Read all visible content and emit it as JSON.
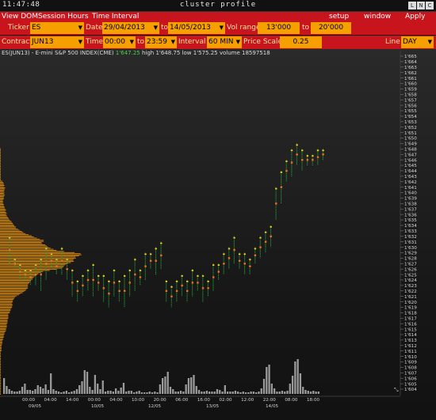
{
  "titlebar": {
    "clock": "11:47:48",
    "title": "cluster profile",
    "buttons": [
      "L",
      "N",
      "C"
    ]
  },
  "menu": {
    "left": [
      "View DOM",
      "Session Hours",
      "Time Interval"
    ],
    "right": [
      "setup",
      "window",
      "Apply"
    ]
  },
  "row1": {
    "ticker_label": "Ticker",
    "ticker_value": "ES",
    "date_label": "Date",
    "date_from": "29/04/2013",
    "to_label": "to",
    "date_to": "14/05/2013",
    "vol_range_label": "Vol range",
    "vol_from": "13'000",
    "vol_to_label": "to",
    "vol_to": "20'000"
  },
  "row2": {
    "contract_label": "Contract",
    "contract_value": "JUN13",
    "time_label": "Time",
    "time_from": "00:00",
    "to_label": "to",
    "time_to": "23:59",
    "interval_label": "Interval",
    "interval_value": "60 MIN",
    "price_scale_label": "Price Scale",
    "price_scale_value": "0.25",
    "line_label": "Line",
    "line_value": "DAY"
  },
  "info": {
    "symbol": "ES(JUN13) - E-mini S&P 500 INDEX(CME)",
    "last": "1'647.25",
    "high": "high 1'648.75",
    "low": "low 1'575.25",
    "volume": "volume 18597518"
  },
  "colors": {
    "menubar": "#c8141c",
    "field": "#f6a000",
    "profile": "#d98a14",
    "cluster_green": "#1f9e3a",
    "cluster_orange": "#ef6d1a",
    "cluster_yellow": "#f5c518"
  },
  "chart_data": {
    "type": "bar",
    "price_axis": {
      "ticks": [
        "1'665",
        "1'664",
        "1'663",
        "1'662",
        "1'661",
        "1'660",
        "1'659",
        "1'658",
        "1'657",
        "1'656",
        "1'655",
        "1'654",
        "1'653",
        "1'652",
        "1'651",
        "1'650",
        "1'649",
        "1'648",
        "1'647",
        "1'646",
        "1'645",
        "1'644",
        "1'643",
        "1'642",
        "1'641",
        "1'640",
        "1'639",
        "1'638",
        "1'637",
        "1'636",
        "1'635",
        "1'634",
        "1'633",
        "1'632",
        "1'631",
        "1'630",
        "1'629",
        "1'628",
        "1'627",
        "1'626",
        "1'625",
        "1'624",
        "1'623",
        "1'622",
        "1'621",
        "1'620",
        "1'619",
        "1'618",
        "1'617",
        "1'616",
        "1'615",
        "1'614",
        "1'613",
        "1'612",
        "1'611",
        "1'610",
        "1'609",
        "1'608",
        "1'607",
        "1'606",
        "1'605",
        "1'604"
      ],
      "range": [
        1603.5,
        1665.5
      ]
    },
    "time_axis": {
      "ticks": [
        "00:00",
        "04:00",
        "14:00",
        "00:00",
        "04:00",
        "10:00",
        "20:00",
        "06:00",
        "16:00",
        "02:00",
        "12:00",
        "22:00",
        "08:00",
        "18:00"
      ],
      "dates": [
        "09/05",
        "10/05",
        "12/05",
        "13/05",
        "14/05"
      ]
    },
    "price_series": [
      {
        "low": 1627,
        "high": 1632
      },
      {
        "low": 1626,
        "high": 1628
      },
      {
        "low": 1624,
        "high": 1627
      },
      {
        "low": 1624,
        "high": 1626
      },
      {
        "low": 1623,
        "high": 1626
      },
      {
        "low": 1623,
        "high": 1627
      },
      {
        "low": 1622,
        "high": 1628
      },
      {
        "low": 1624,
        "high": 1630
      },
      {
        "low": 1626,
        "high": 1629
      },
      {
        "low": 1625,
        "high": 1628
      },
      {
        "low": 1625,
        "high": 1630
      },
      {
        "low": 1624,
        "high": 1628
      },
      {
        "low": 1621,
        "high": 1626
      },
      {
        "low": 1620,
        "high": 1624
      },
      {
        "low": 1621,
        "high": 1625
      },
      {
        "low": 1622,
        "high": 1626
      },
      {
        "low": 1621,
        "high": 1627
      },
      {
        "low": 1622,
        "high": 1625
      },
      {
        "low": 1620,
        "high": 1625
      },
      {
        "low": 1619,
        "high": 1624
      },
      {
        "low": 1621,
        "high": 1626
      },
      {
        "low": 1620,
        "high": 1624
      },
      {
        "low": 1619,
        "high": 1625
      },
      {
        "low": 1621,
        "high": 1626
      },
      {
        "low": 1622,
        "high": 1628
      },
      {
        "low": 1623,
        "high": 1626
      },
      {
        "low": 1624,
        "high": 1629
      },
      {
        "low": 1626,
        "high": 1629
      },
      {
        "low": 1625,
        "high": 1630
      },
      {
        "low": 1626,
        "high": 1631
      },
      {
        "low": 1620,
        "high": 1624
      },
      {
        "low": 1619,
        "high": 1623
      },
      {
        "low": 1620,
        "high": 1624
      },
      {
        "low": 1621,
        "high": 1625
      },
      {
        "low": 1620,
        "high": 1624
      },
      {
        "low": 1621,
        "high": 1626
      },
      {
        "low": 1622,
        "high": 1625
      },
      {
        "low": 1620,
        "high": 1625
      },
      {
        "low": 1621,
        "high": 1624
      },
      {
        "low": 1622,
        "high": 1627
      },
      {
        "low": 1624,
        "high": 1627
      },
      {
        "low": 1625,
        "high": 1629
      },
      {
        "low": 1626,
        "high": 1630
      },
      {
        "low": 1627,
        "high": 1632
      },
      {
        "low": 1626,
        "high": 1629
      },
      {
        "low": 1625,
        "high": 1629
      },
      {
        "low": 1625,
        "high": 1628
      },
      {
        "low": 1627,
        "high": 1630
      },
      {
        "low": 1628,
        "high": 1632
      },
      {
        "low": 1629,
        "high": 1633
      },
      {
        "low": 1630,
        "high": 1634
      },
      {
        "low": 1635,
        "high": 1641
      },
      {
        "low": 1638,
        "high": 1644
      },
      {
        "low": 1642,
        "high": 1646
      },
      {
        "low": 1643,
        "high": 1648
      },
      {
        "low": 1645,
        "high": 1649
      },
      {
        "low": 1644,
        "high": 1648
      },
      {
        "low": 1645,
        "high": 1647
      },
      {
        "low": 1645,
        "high": 1647
      },
      {
        "low": 1645,
        "high": 1648
      },
      {
        "low": 1646,
        "high": 1648
      }
    ],
    "volume_series": [
      20,
      10,
      6,
      4,
      3,
      3,
      4,
      9,
      13,
      5,
      5,
      4,
      6,
      11,
      9,
      7,
      12,
      5,
      26,
      6,
      4,
      3,
      2,
      3,
      4,
      2,
      3,
      4,
      6,
      11,
      16,
      30,
      28,
      9,
      5,
      24,
      13,
      6,
      17,
      3,
      4,
      4,
      3,
      7,
      4,
      8,
      14,
      3,
      4,
      4,
      2,
      3,
      4,
      2,
      2,
      2,
      3,
      2,
      3,
      2,
      12,
      20,
      22,
      28,
      9,
      6,
      3,
      3,
      4,
      3,
      12,
      20,
      21,
      24,
      10,
      5,
      3,
      3,
      4,
      3,
      3,
      3,
      6,
      5,
      3,
      11,
      3,
      3,
      3,
      4,
      3,
      2,
      3,
      2,
      2,
      3,
      3,
      2,
      3,
      7,
      19,
      34,
      37,
      13,
      7,
      3,
      3,
      4,
      3,
      4,
      13,
      23,
      41,
      44,
      26,
      9,
      5,
      4,
      3,
      4,
      3,
      3
    ],
    "volume_profile": [
      1,
      1,
      1,
      1,
      1,
      1,
      1,
      1,
      1,
      1,
      1,
      1,
      1,
      1,
      1,
      1,
      1,
      1,
      1,
      1,
      1,
      1,
      1,
      1,
      1,
      1,
      1,
      1,
      1,
      3,
      4,
      5,
      5,
      6,
      5,
      7,
      6,
      6,
      5,
      6,
      5,
      6,
      6,
      5,
      5,
      5,
      4,
      4,
      4,
      4,
      5,
      5,
      6,
      6,
      7,
      8,
      7,
      8,
      9,
      8,
      9,
      10,
      11,
      12,
      13,
      15,
      16,
      17,
      18,
      19,
      21,
      21,
      24,
      26,
      29,
      31,
      34,
      38,
      42,
      45,
      49,
      53,
      58,
      58,
      55,
      56,
      60,
      62,
      64,
      67,
      71,
      75,
      85,
      99,
      107,
      108,
      105,
      100,
      101,
      98,
      97,
      98,
      94,
      90,
      87,
      85,
      84,
      82,
      75,
      66,
      57,
      54,
      51,
      49,
      47,
      45,
      44,
      43,
      41,
      40,
      39,
      38,
      37,
      37,
      37,
      37,
      35,
      34,
      32,
      30,
      27,
      25,
      22,
      20,
      19,
      18,
      17,
      17,
      16,
      16,
      17,
      16,
      16,
      15,
      14,
      14,
      13,
      13,
      11,
      11,
      11,
      11,
      11,
      10,
      10,
      10,
      10,
      9,
      9,
      9,
      9,
      8,
      8,
      8,
      7,
      6,
      6,
      5,
      5,
      5,
      4,
      4,
      3,
      3,
      3,
      3,
      2,
      2,
      2,
      2,
      2,
      2,
      1,
      1,
      1,
      1,
      1,
      1,
      1,
      1,
      1,
      1,
      1,
      1,
      1,
      1,
      1,
      1,
      1,
      1,
      1,
      1,
      1,
      1,
      1,
      1,
      1,
      1,
      1,
      1,
      1,
      1,
      1,
      1,
      1,
      1,
      1,
      1,
      1,
      1,
      1
    ]
  }
}
